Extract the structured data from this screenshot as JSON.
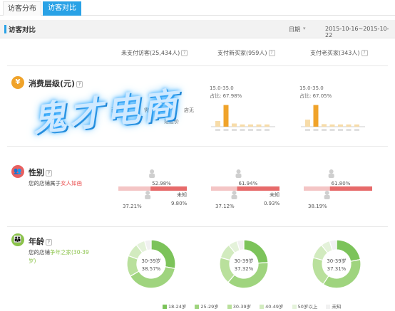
{
  "tabs": [
    {
      "label": "访客分布",
      "active": false
    },
    {
      "label": "访客对比",
      "active": true
    }
  ],
  "header": {
    "title": "访客对比",
    "date_label": "日期",
    "date_range": "2015-10-16~2015-10-22"
  },
  "columns": [
    {
      "label": "未支付访客(25,434人)"
    },
    {
      "label": "支付新买家(959人)"
    },
    {
      "label": "支付老买家(343人)"
    }
  ],
  "sections": {
    "spend": {
      "title": "消费层级(元)",
      "desc_fragments": [
        "面",
        "需求在彩",
        "店无",
        "适层价"
      ],
      "col2_tip": {
        "range": "15.0-35.0",
        "ratio": "占比: 67.98%"
      },
      "col3_tip": {
        "range": "15.0-35.0",
        "ratio": "占比: 67.05%"
      }
    },
    "gender": {
      "title": "性别",
      "desc_prefix": "您的店铺属于",
      "desc_highlight": "女人如画",
      "unknown_label": "未知",
      "cols": [
        {
          "female_pct": "52.98%",
          "male_pct": "37.21%",
          "unknown_pct": "9.80%"
        },
        {
          "female_pct": "61.94%",
          "male_pct": "37.12%",
          "unknown_pct": "0.93%"
        },
        {
          "female_pct": "61.80%",
          "male_pct": "38.19%",
          "unknown_pct": ""
        }
      ]
    },
    "age": {
      "title": "年龄",
      "desc_prefix": "您的店铺",
      "desc_highlight": "争年之家(30-39岁)",
      "cols": [
        {
          "center_label": "30-39岁",
          "center_pct": "38.57%"
        },
        {
          "center_label": "30-39岁",
          "center_pct": "37.32%"
        },
        {
          "center_label": "30-39岁",
          "center_pct": "37.31%"
        }
      ],
      "legend": [
        {
          "label": "18-24岁",
          "color": "#7cc35a"
        },
        {
          "label": "25-29岁",
          "color": "#9fd47e"
        },
        {
          "label": "30-39岁",
          "color": "#b9e09c"
        },
        {
          "label": "40-49岁",
          "color": "#d2ebbf"
        },
        {
          "label": "50岁以上",
          "color": "#e4f2da"
        },
        {
          "label": "未知",
          "color": "#f1f1f1"
        }
      ]
    }
  },
  "watermark": "鬼才电商",
  "chart_data": [
    {
      "type": "bar",
      "title": "",
      "values": [
        18,
        68,
        10,
        7,
        7,
        7,
        7
      ],
      "color": "#f0a32a"
    },
    {
      "type": "bar",
      "title": "",
      "values": [
        22,
        68,
        8,
        7,
        7,
        7,
        7
      ],
      "color": "#f0a32a"
    },
    {
      "type": "pie",
      "title": "",
      "values": [
        28,
        38.57,
        14,
        9,
        6,
        4.43
      ]
    },
    {
      "type": "pie",
      "title": "",
      "values": [
        24,
        37.32,
        18,
        10,
        6,
        4.68
      ]
    },
    {
      "type": "pie",
      "title": "",
      "values": [
        22,
        37.31,
        20,
        10,
        6,
        4.69
      ]
    }
  ],
  "colors": {
    "accent": "#29a2e6",
    "bar": "#f0a32a",
    "female": "#e76a6a",
    "female_light": "#f4c5c5"
  },
  "icons": {
    "spend": "yen-icon",
    "gender": "people-icon",
    "age": "family-icon"
  }
}
